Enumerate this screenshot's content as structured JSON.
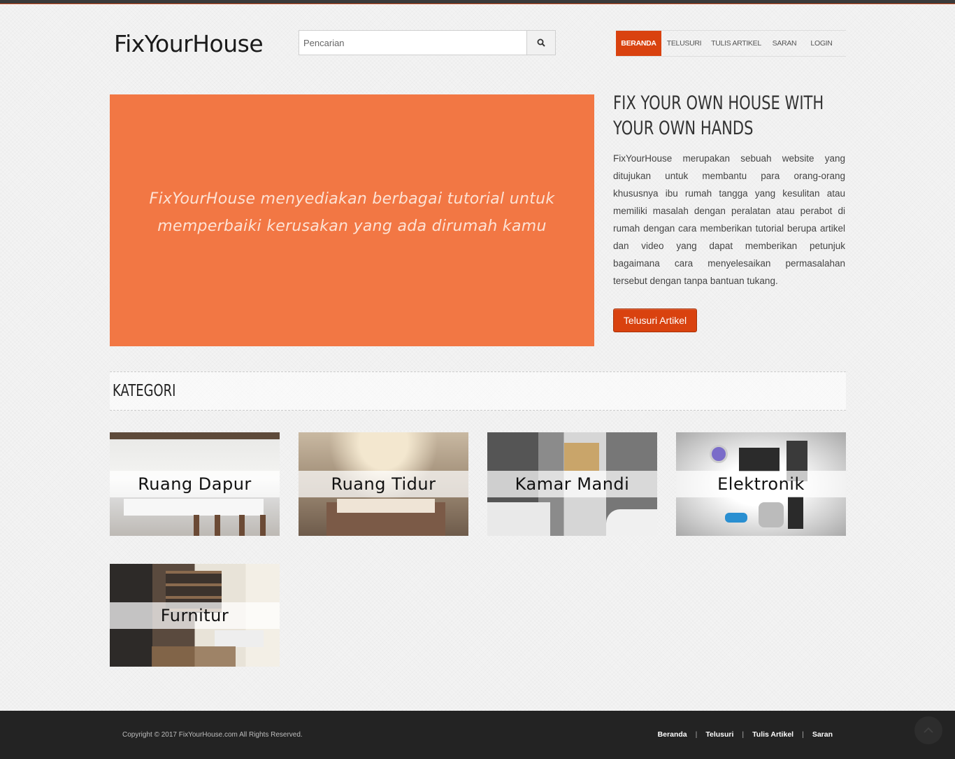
{
  "header": {
    "logo": "FixYourHouse",
    "search_placeholder": "Pencarian",
    "nav": [
      {
        "label": "BERANDA",
        "active": true
      },
      {
        "label": "TELUSURI",
        "active": false
      },
      {
        "label": "TULIS ARTIKEL",
        "active": false
      },
      {
        "label": "SARAN",
        "active": false
      },
      {
        "label": "LOGIN",
        "active": false
      }
    ]
  },
  "hero": {
    "banner_line1": "FixYourHouse menyediakan berbagai tutorial untuk",
    "banner_line2": "memperbaiki kerusakan yang ada dirumah kamu",
    "title": "FIX YOUR OWN HOUSE WITH YOUR OWN HANDS",
    "description": "FixYourHouse merupakan sebuah website yang ditujukan untuk membantu para orang-orang khususnya ibu rumah tangga yang kesulitan atau memiliki masalah dengan peralatan atau perabot di rumah dengan cara memberikan tutorial berupa artikel dan video yang dapat memberikan petunjuk bagaimana cara menyelesaikan permasalahan tersebut dengan tanpa bantuan tukang.",
    "cta_label": "Telusuri Artikel"
  },
  "kategori": {
    "title": "KATEGORI",
    "items": [
      {
        "label": "Ruang Dapur"
      },
      {
        "label": "Ruang Tidur"
      },
      {
        "label": "Kamar Mandi"
      },
      {
        "label": "Elektronik"
      },
      {
        "label": "Furnitur"
      }
    ]
  },
  "footer": {
    "copyright": "Copyright © 2017 FixYourHouse.com All Rights Reserved.",
    "links": [
      "Beranda",
      "Telusuri",
      "Tulis Artikel",
      "Saran"
    ]
  },
  "colors": {
    "accent": "#d9420f",
    "hero_bg": "#f27744",
    "footer_bg": "#232323"
  }
}
